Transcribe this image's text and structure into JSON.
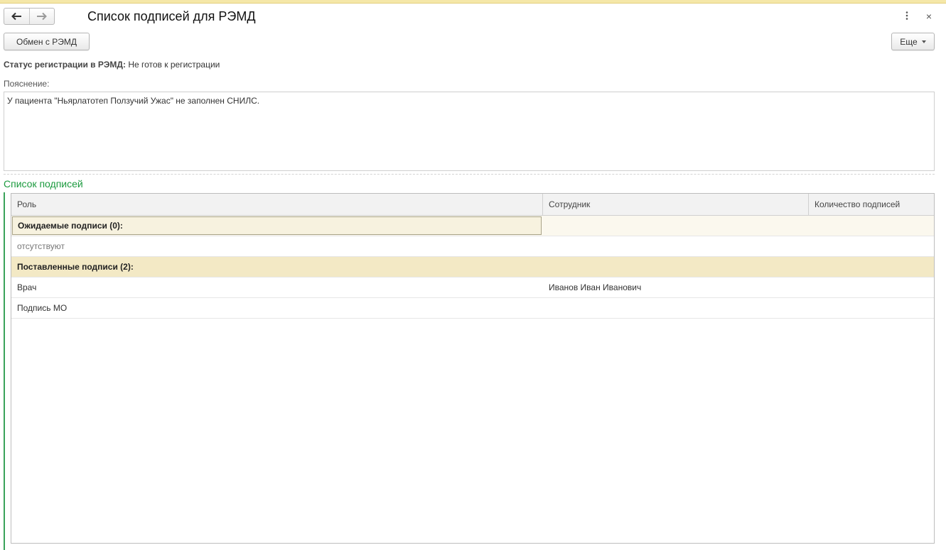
{
  "window": {
    "title": "Список подписей для РЭМД",
    "back_icon": "arrow-left-icon",
    "forward_icon": "arrow-right-icon",
    "menu_icon": "more-vertical-icon",
    "close_glyph": "×"
  },
  "toolbar": {
    "exchange_label": "Обмен с РЭМД",
    "more_label": "Еще"
  },
  "status": {
    "label": "Статус регистрации в РЭМД:",
    "value": "Не готов к регистрации"
  },
  "explanation": {
    "label": "Пояснение:",
    "text": "У пациента \"Ньярлатотеп Ползучий Ужас\" не заполнен СНИЛС."
  },
  "signatures": {
    "group_title": "Список подписей",
    "columns": {
      "role": "Роль",
      "employee": "Сотрудник",
      "count": "Количество подписей"
    },
    "expected_group": "Ожидаемые подписи (0):",
    "expected_empty": "отсутствуют",
    "placed_group": "Поставленные подписи (2):",
    "rows": [
      {
        "role": "Врач",
        "employee": "Иванов Иван Иванович",
        "count": ""
      },
      {
        "role": "Подпись МО",
        "employee": "",
        "count": ""
      }
    ]
  },
  "colors": {
    "accent_green": "#1b9a3e",
    "group_highlight": "#f3e9c5",
    "top_strip": "#f5e7a8"
  }
}
